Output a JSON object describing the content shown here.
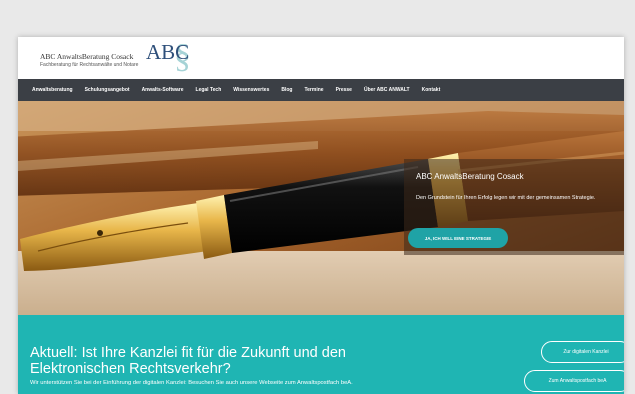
{
  "header": {
    "brand_name": "ABC AnwaltsBeratung Cosack",
    "brand_subtitle": "Fachberatung für Rechtsanwälte und Notare",
    "logo_text": "ABC",
    "logo_text_secondary": "§",
    "logo_colors": {
      "dark": "#2e4f7a",
      "teal": "#5fb0b5"
    }
  },
  "nav": {
    "items": [
      {
        "label": "Anwaltsberatung"
      },
      {
        "label": "Schulungsangebot"
      },
      {
        "label": "Anwalts-Software"
      },
      {
        "label": "Legal Tech"
      },
      {
        "label": "Wissenswertes"
      },
      {
        "label": "Blog"
      },
      {
        "label": "Termine"
      },
      {
        "label": "Presse"
      },
      {
        "label": "Über ABC ANWALT"
      },
      {
        "label": "Kontakt"
      }
    ]
  },
  "hero": {
    "title": "ABC AnwaltsBeratung Cosack",
    "text": "Den Grundstein für Ihren Erfolg legen wir mit der gemeinsamen Strategie.",
    "cta_label": "JA, ICH WILL EINE STRATEGIE"
  },
  "banner": {
    "title": "Aktuell: Ist Ihre Kanzlei fit für die Zukunft und den Elektronischen Rechtsverkehr?",
    "text": "Wir unterstützen Sie bei der Einführung der digitalen Kanzlei: Besuchen Sie auch unsere Webseite zum Anwaltspostfach beA.",
    "button_1": "Zur digitalen Kanzlei",
    "button_2": "Zum Anwaltspostfach beA"
  },
  "colors": {
    "accent_teal": "#1fb5b3",
    "cta_teal": "#1fa3a6",
    "nav_bg": "#3b3f45"
  }
}
